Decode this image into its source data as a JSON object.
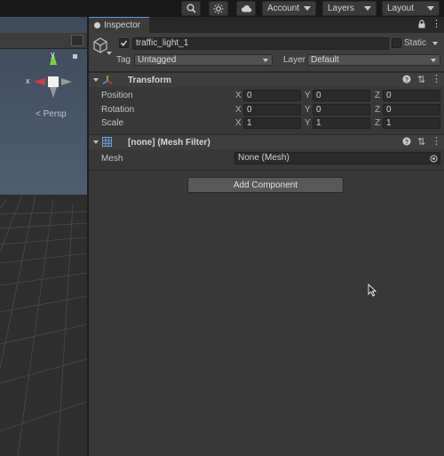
{
  "toolbar": {
    "account_label": "Account",
    "layers_label": "Layers",
    "layout_label": "Layout"
  },
  "scene": {
    "persp_label": "< Persp",
    "gizmo_y": "y",
    "gizmo_x": "x"
  },
  "inspector": {
    "tab_label": "Inspector",
    "object_name": "traffic_light_1",
    "static_label": "Static",
    "tag_label": "Tag",
    "tag_value": "Untagged",
    "layer_label": "Layer",
    "layer_value": "Default",
    "add_component_label": "Add Component"
  },
  "transform": {
    "title": "Transform",
    "rows": [
      {
        "label": "Position",
        "x": "0",
        "y": "0",
        "z": "0"
      },
      {
        "label": "Rotation",
        "x": "0",
        "y": "0",
        "z": "0"
      },
      {
        "label": "Scale",
        "x": "1",
        "y": "1",
        "z": "1"
      }
    ],
    "axis_x": "X",
    "axis_y": "Y",
    "axis_z": "Z"
  },
  "mesh_filter": {
    "title": "[none] (Mesh Filter)",
    "mesh_label": "Mesh",
    "mesh_value": "None (Mesh)"
  },
  "colors": {
    "accent": "#5a9ae6",
    "gizmo_red": "#d23c3c",
    "gizmo_green": "#7fd23c"
  }
}
